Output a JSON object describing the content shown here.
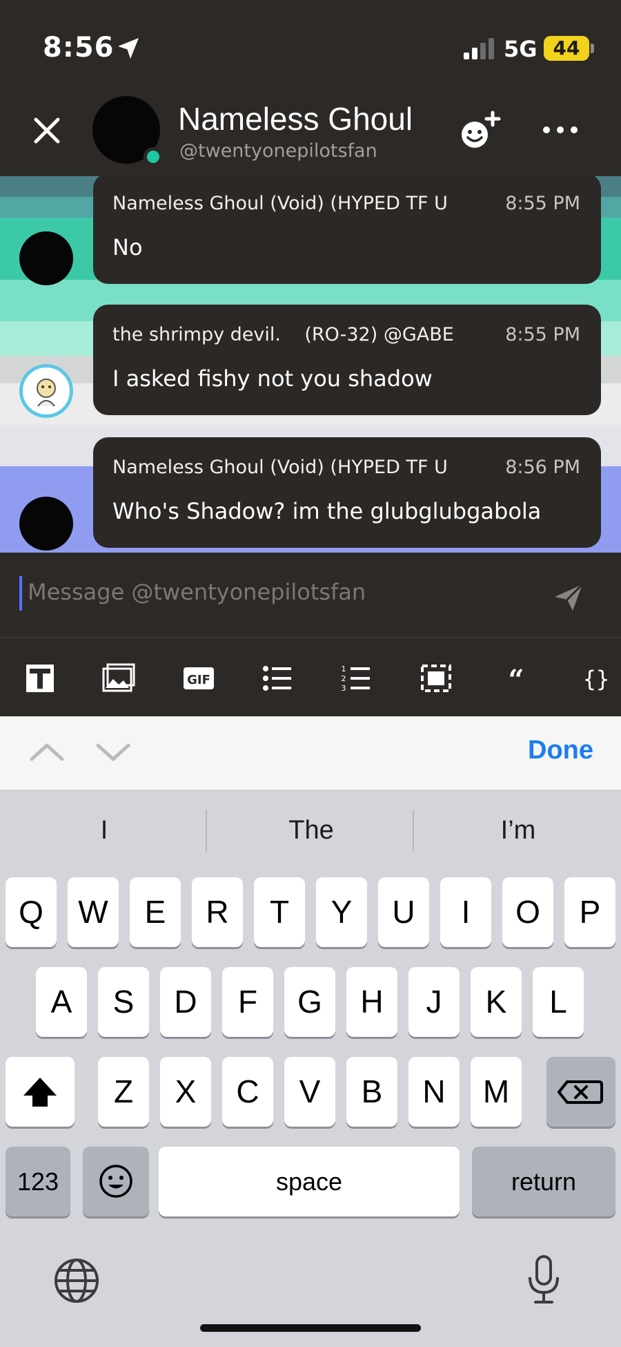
{
  "status_bar": {
    "time": "8:56",
    "network": "5G",
    "battery": "44"
  },
  "header": {
    "name": "Nameless Ghoul",
    "handle": "@twentyonepilotsfan"
  },
  "messages": [
    {
      "author": "Nameless Ghoul (Void) (HYPED TF U",
      "time": "8:55 PM",
      "text": "No"
    },
    {
      "author": "the shrimpy devil.    (RO-32) @GABE",
      "time": "8:55 PM",
      "text": "I asked fishy not you shadow"
    },
    {
      "author": "Nameless Ghoul (Void) (HYPED TF U",
      "time": "8:56 PM",
      "text": "Who's Shadow? im the glubglubgabola"
    }
  ],
  "composer": {
    "placeholder": "Message @twentyonepilotsfan"
  },
  "toolbar": {
    "tools": [
      "text-format-icon",
      "image-icon",
      "gif-icon",
      "bullet-list-icon",
      "numbered-list-icon",
      "spoiler-icon",
      "quote-icon",
      "code-block-icon"
    ],
    "gif_label": "GIF",
    "quote_label": "66",
    "code_label": "{}"
  },
  "keyboard": {
    "done_label": "Done",
    "suggestions": [
      "I",
      "The",
      "I’m"
    ],
    "row1": [
      "Q",
      "W",
      "E",
      "R",
      "T",
      "Y",
      "U",
      "I",
      "O",
      "P"
    ],
    "row2": [
      "A",
      "S",
      "D",
      "F",
      "G",
      "H",
      "J",
      "K",
      "L"
    ],
    "row3": [
      "Z",
      "X",
      "C",
      "V",
      "B",
      "N",
      "M"
    ],
    "numbers_label": "123",
    "space_label": "space",
    "return_label": "return"
  },
  "colors": {
    "background": "#2d2927",
    "online": "#1fc7a3",
    "accent": "#1b7df0",
    "band_teal": "#3cc9a8",
    "band_purple": "#8f9cf0"
  }
}
